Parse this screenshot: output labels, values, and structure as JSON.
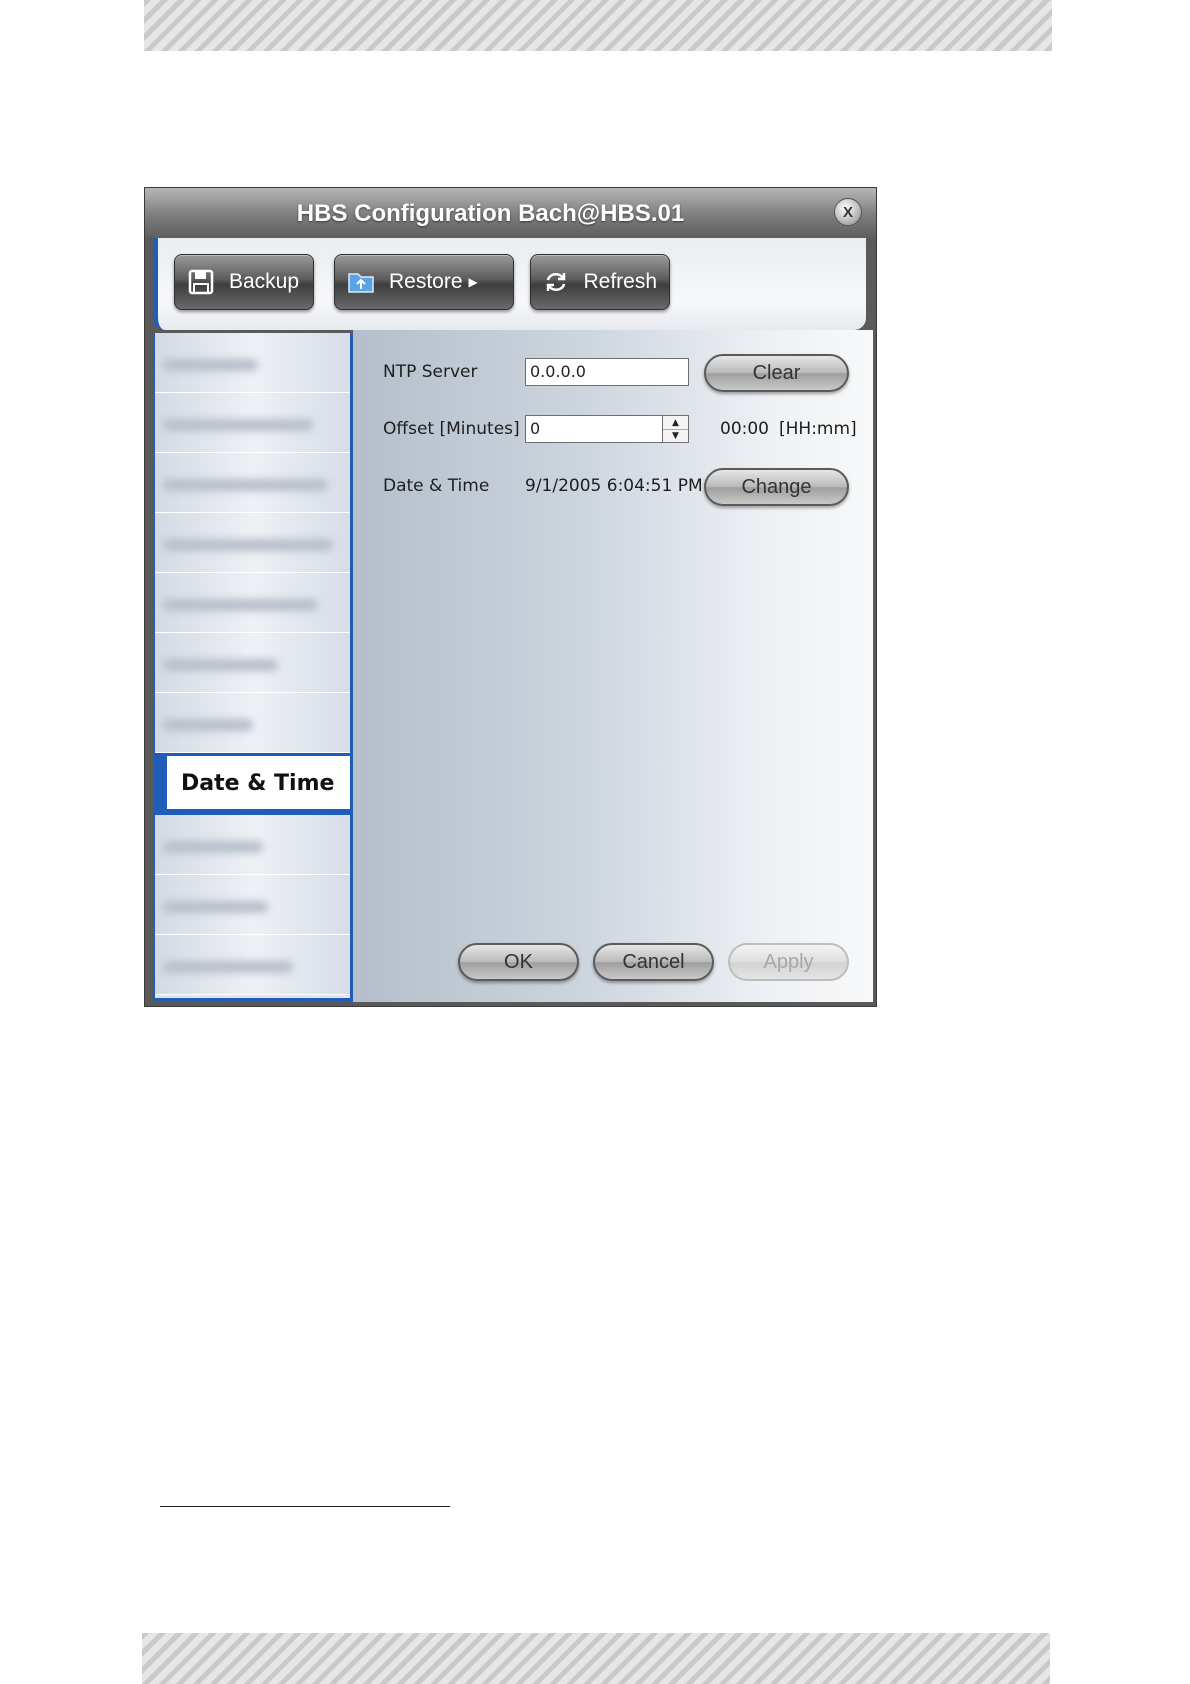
{
  "window": {
    "title": "HBS Configuration Bach@HBS.01",
    "close_glyph": "X"
  },
  "toolbar": {
    "backup_label": "Backup",
    "restore_label": "Restore",
    "refresh_label": "Refresh"
  },
  "sidebar": {
    "active_label": "Date & Time"
  },
  "form": {
    "ntp_server_label": "NTP Server",
    "ntp_server_value": "0.0.0.0",
    "offset_label": "Offset [Minutes]",
    "offset_value": "0",
    "offset_time": "00:00",
    "offset_format": "[HH:mm]",
    "datetime_label": "Date & Time",
    "datetime_value": "9/1/2005 6:04:51 PM",
    "clear_label": "Clear",
    "change_label": "Change"
  },
  "footer": {
    "ok_label": "OK",
    "cancel_label": "Cancel",
    "apply_label": "Apply"
  },
  "colors": {
    "accent_blue": "#1f5db8"
  }
}
